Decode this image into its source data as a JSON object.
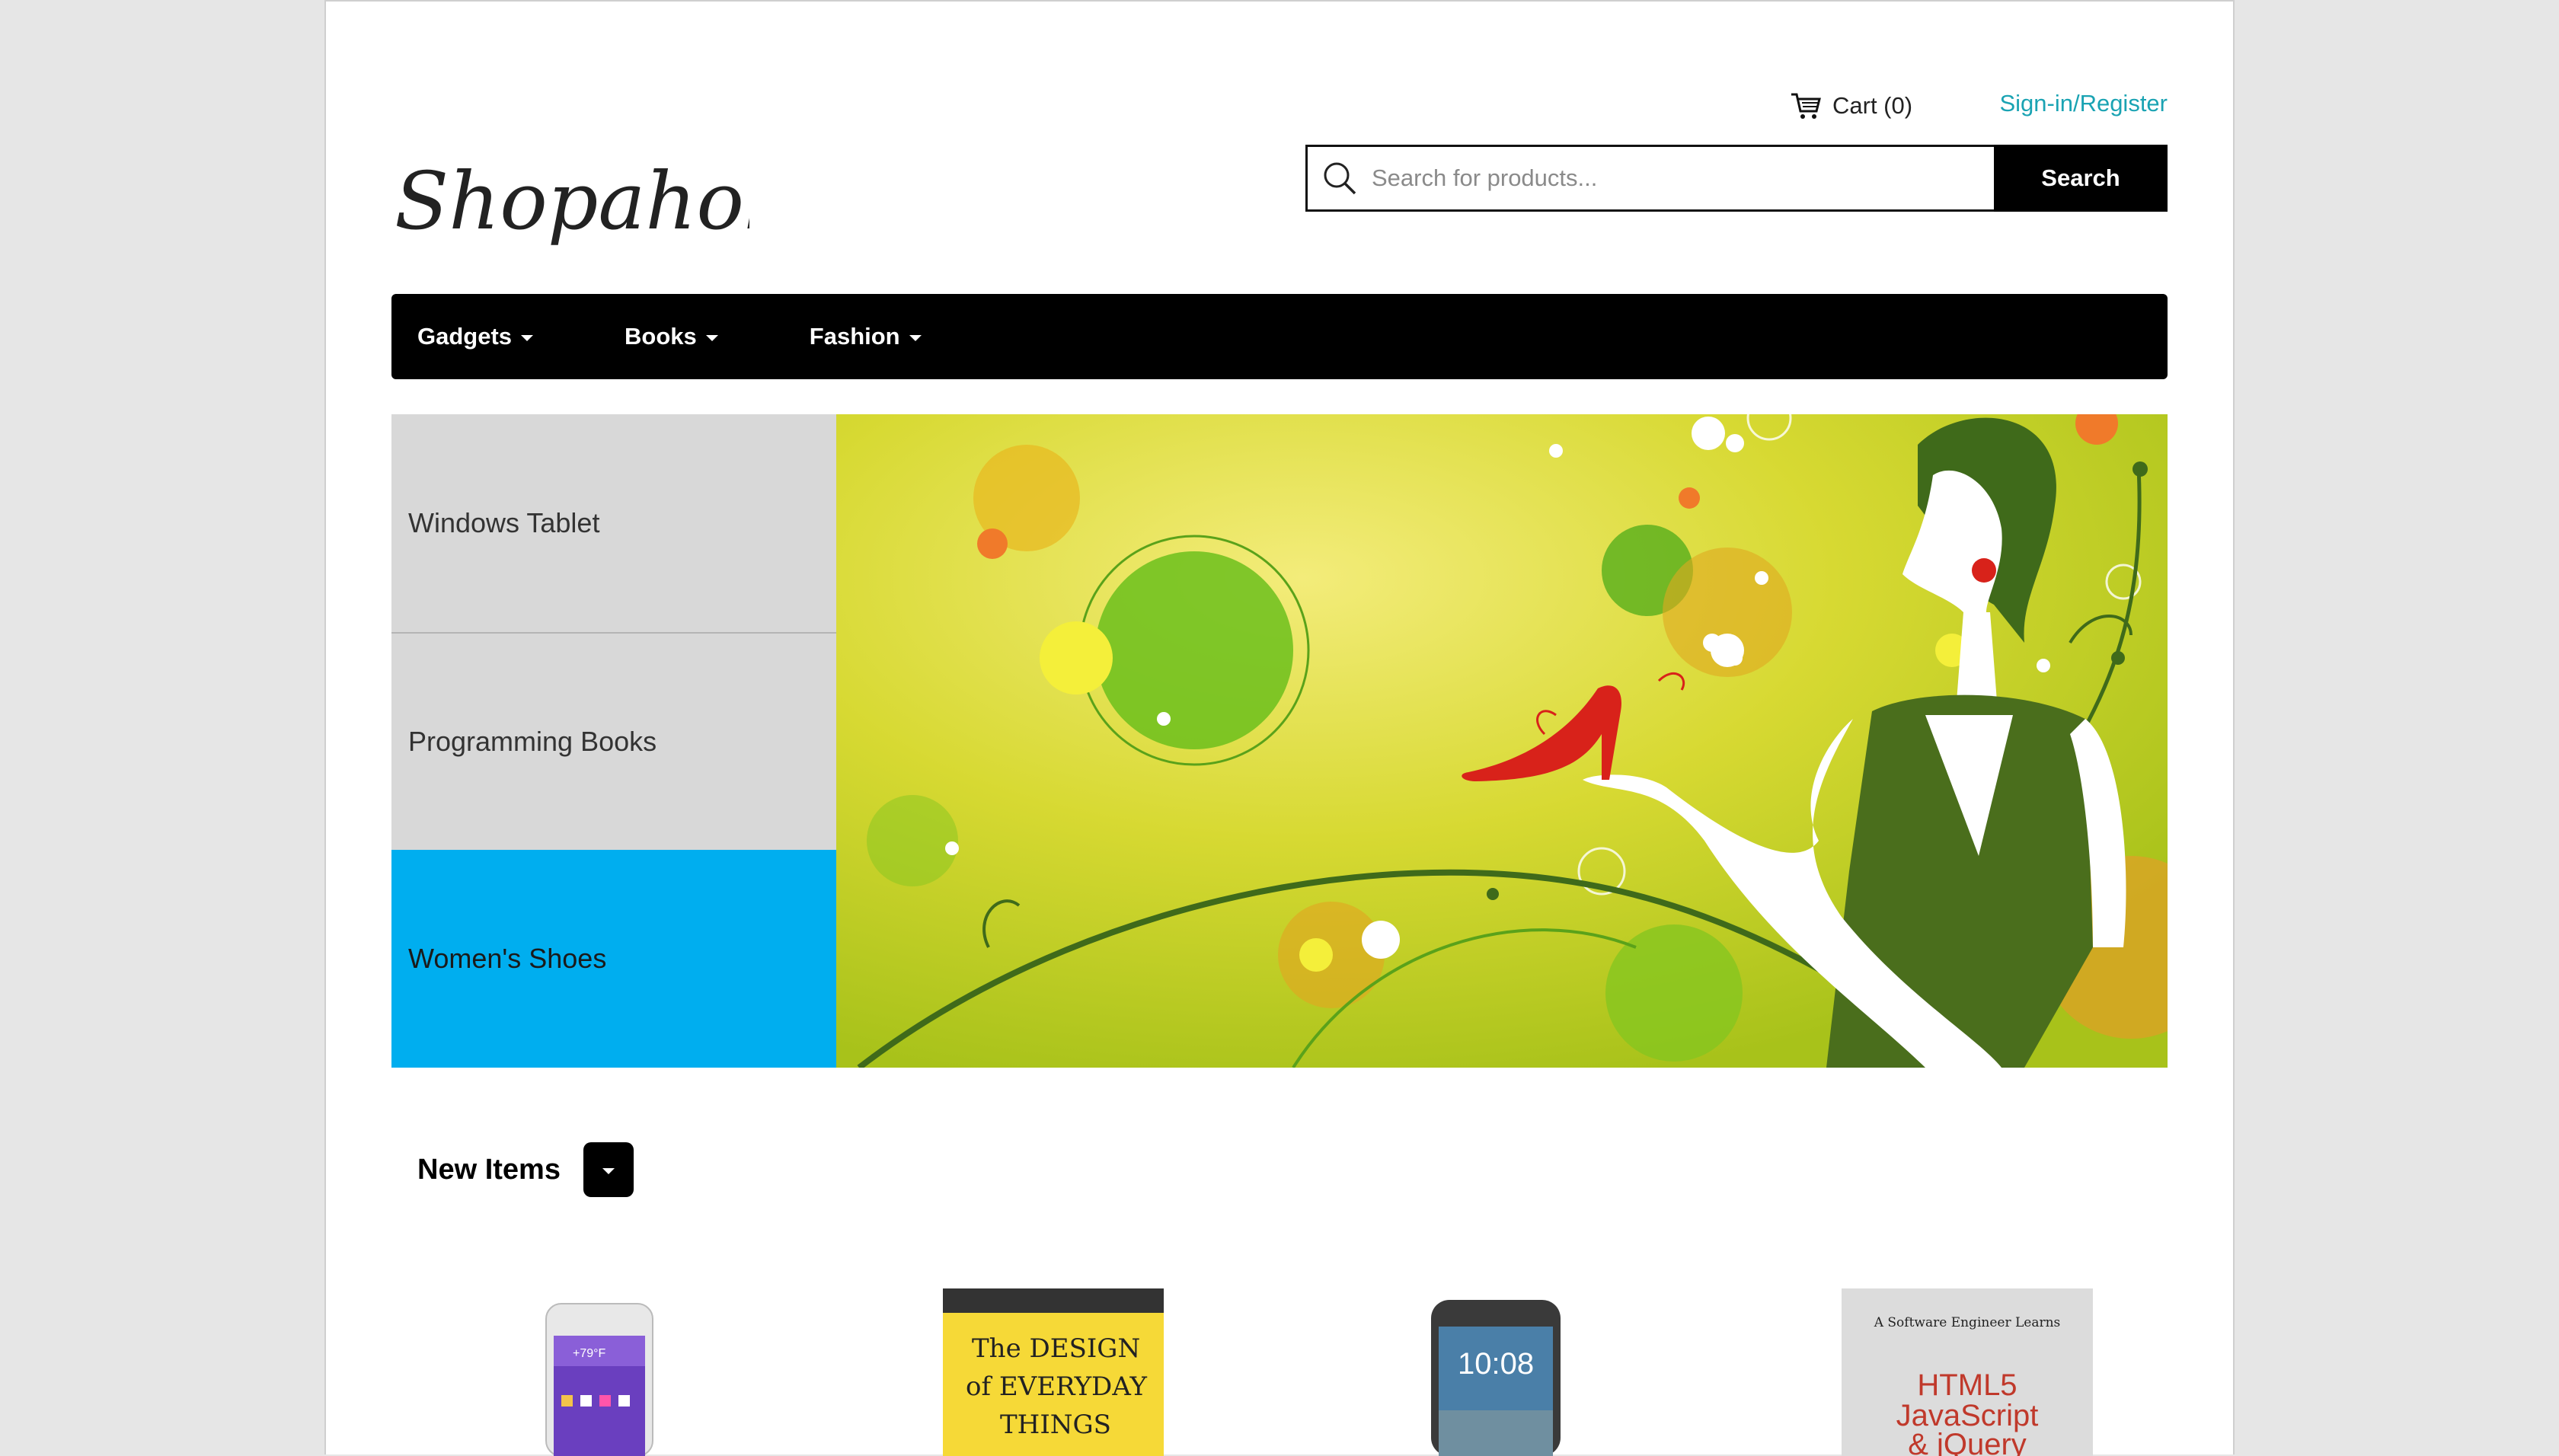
{
  "header": {
    "logo_text": "Shopaholic",
    "cart_label": "Cart (0)",
    "signin_label": "Sign-in/Register",
    "search_placeholder": "Search for products...",
    "search_button": "Search"
  },
  "nav": {
    "items": [
      {
        "label": "Gadgets"
      },
      {
        "label": "Books"
      },
      {
        "label": "Fashion"
      }
    ]
  },
  "hero": {
    "side_items": [
      {
        "label": "Windows Tablet"
      },
      {
        "label": "Programming Books"
      },
      {
        "label": "Women's Shoes"
      }
    ]
  },
  "new_items": {
    "title": "New Items"
  },
  "products": {
    "book1": {
      "line1": "The DESIGN",
      "line2": "of EVERYDAY",
      "line3": "THINGS"
    },
    "phone2": {
      "time": "10:08"
    },
    "book2": {
      "top": "A Software Engineer Learns",
      "line1": "HTML5",
      "line2": "JavaScript",
      "line3": "& jQuery"
    },
    "phone1": {
      "temp": "+79°F"
    }
  },
  "colors": {
    "accent": "#00aeef",
    "link": "#1aa3b3",
    "nav_bg": "#000000"
  }
}
